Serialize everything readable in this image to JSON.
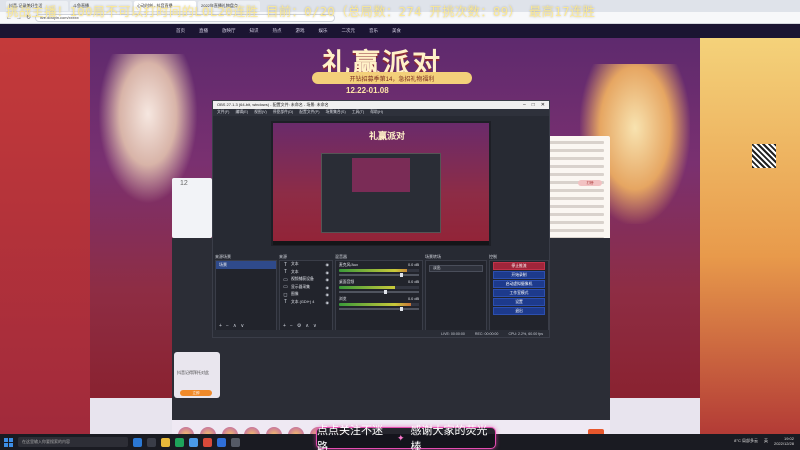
{
  "overlay": {
    "text": "挑战主播！100局不可以打时间的LOL20连胜    目前：0/20（总局数：274 开挑次数：89） 最高17连胜"
  },
  "browser": {
    "tabs": [
      "抖音-记录美好生活",
      "斗鱼直播",
      "心动时刻 - 抖音直播",
      "2022年直播礼物盘点"
    ],
    "url": "live.douyin.com/xxxxx"
  },
  "site": {
    "nav": [
      "首页",
      "直播",
      "放映厅",
      "知识",
      "热点",
      "游戏",
      "娱乐",
      "二次元",
      "音乐",
      "美食"
    ],
    "banner": {
      "title": "礼赢派对",
      "subtitle": "开钻招募季第14，急招礼物福利",
      "date": "12.22-01.08"
    },
    "viewer_count": "12",
    "gift_button": "打榜",
    "follow_card": {
      "text": "抖音记得拜托对此",
      "button": "立即"
    }
  },
  "obs": {
    "title": "OBS 27.1.3 (64-bit, windows) - 配置文件: 未命名 - 场景: 未命名",
    "menu": [
      "文件(F)",
      "编辑(E)",
      "视图(V)",
      "停靠部件(D)",
      "配置文件(P)",
      "场景集合(S)",
      "工具(T)",
      "帮助(H)"
    ],
    "docks": {
      "scenes": "来源场景",
      "sources": "来源",
      "mixer": "混音器",
      "transitions": "场景转场",
      "controls": "控制"
    },
    "scenes": [
      "场景"
    ],
    "sources": [
      {
        "icon": "T",
        "name": "文本"
      },
      {
        "icon": "T",
        "name": "文本"
      },
      {
        "icon": "▭",
        "name": "视频捕获设备"
      },
      {
        "icon": "▭",
        "name": "显示器采集"
      },
      {
        "icon": "◻",
        "name": "图像"
      },
      {
        "icon": "T",
        "name": "文本 (GDI+) 4"
      }
    ],
    "mixer": [
      {
        "name": "麦克风/Aux",
        "db": "0.0 dB",
        "level": 0.85,
        "volume": 0.8
      },
      {
        "name": "桌面音频",
        "db": "0.0 dB",
        "level": 0.7,
        "volume": 0.6
      },
      {
        "name": "浏览",
        "db": "0.0 dB",
        "level": 0.9,
        "volume": 0.8
      }
    ],
    "transition": "淡出",
    "controls": [
      "停止推流",
      "开始录制",
      "启动虚拟摄像机",
      "工作室模式",
      "设置",
      "退出"
    ],
    "status": {
      "live": "LIVE: 00:00:00",
      "rec": "REC: 00:00:00",
      "cpu": "CPU: 2.2%, 60.00 fps"
    }
  },
  "taskbar": {
    "search": "在这里输入你要搜索的内容",
    "weather": "8°C 局部多云",
    "ime": "英",
    "time": "19:02",
    "date": "2022/12/28"
  },
  "promo": {
    "left": "点点关注不迷路",
    "right": "感谢大家的荧光棒"
  }
}
